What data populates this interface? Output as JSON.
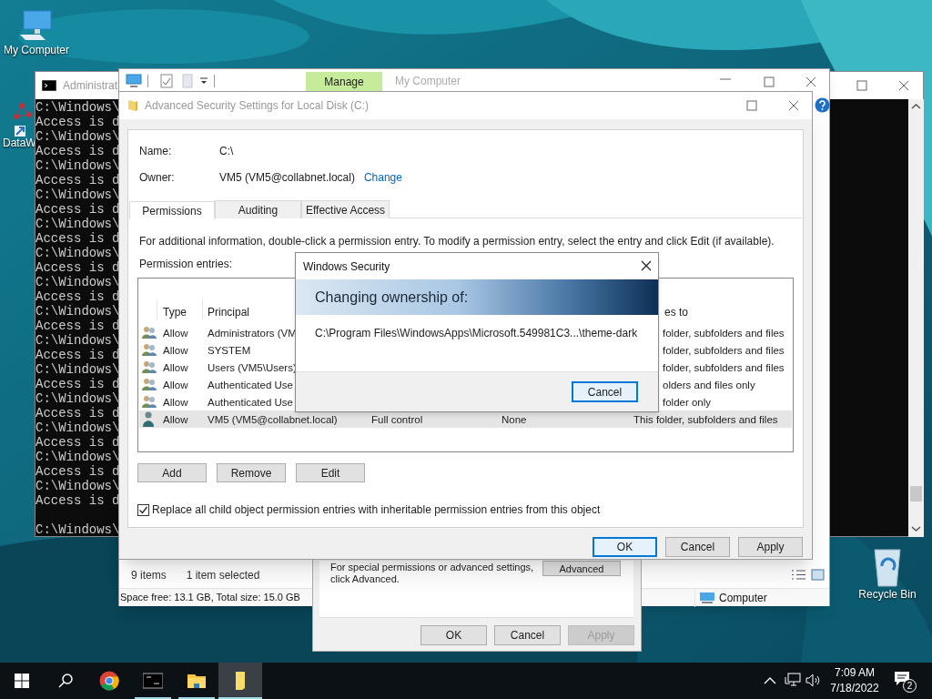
{
  "desktop_icons": [
    {
      "kind": "computer",
      "label": "My Computer"
    },
    {
      "kind": "shortcut",
      "label": "DataW"
    },
    {
      "kind": "recycle_bin",
      "label": "Recycle Bin"
    }
  ],
  "console_window": {
    "title": "Administrat",
    "lines": [
      "C:\\Windows\\",
      "Access is d",
      "C:\\Windows\\",
      "Access is d",
      "C:\\Windows\\",
      "Access is d",
      "C:\\Windows\\",
      "Access is d",
      "C:\\Windows\\",
      "Access is d",
      "C:\\Windows\\",
      "Access is d",
      "C:\\Windows\\",
      "Access is d",
      "C:\\Windows\\",
      "Access is d",
      "C:\\Windows\\",
      "Access is d",
      "C:\\Windows\\",
      "Access is d",
      "C:\\Windows\\",
      "Access is d",
      "C:\\Windows\\",
      "Access is d",
      "C:\\Windows\\",
      "Access is d",
      "C:\\Windows\\",
      "Access is d"
    ],
    "prompt": "C:\\Windows\\"
  },
  "explorer_window": {
    "ribbon_tab": "Manage",
    "title": "My Computer",
    "item_count": "9 items",
    "selection": "1 item selected",
    "details": "Space free: 13.1 GB, Total size: 15.0 GB",
    "location": "Computer"
  },
  "properties_dialog": {
    "text_lines": [
      "For special permissions or advanced settings,",
      "click Advanced."
    ],
    "advanced_button": "Advanced",
    "buttons": [
      {
        "label": "OK",
        "disabled": false
      },
      {
        "label": "Cancel",
        "disabled": false
      },
      {
        "label": "Apply",
        "disabled": true
      }
    ]
  },
  "advanced_security": {
    "title": "Advanced Security Settings for Local Disk (C:)",
    "name_label": "Name:",
    "name": "C:\\",
    "owner_label": "Owner:",
    "owner": "VM5 (VM5@collabnet.local)",
    "change_link": "Change",
    "tabs": [
      {
        "label": "Permissions",
        "selected": true
      },
      {
        "label": "Auditing",
        "selected": false
      },
      {
        "label": "Effective Access",
        "selected": false
      }
    ],
    "info": "For additional information, double-click a permission entry. To modify a permission entry, select the entry and click Edit (if available).",
    "entries_label": "Permission entries:",
    "columns": [
      "Type",
      "Principal",
      "es to"
    ],
    "rows": [
      {
        "kind": "group",
        "type": "Allow",
        "principal": "Administrators (VM",
        "applies_to": "folder, subfolders and files",
        "selected": false
      },
      {
        "kind": "group",
        "type": "Allow",
        "principal": "SYSTEM",
        "applies_to": "folder, subfolders and files",
        "selected": false
      },
      {
        "kind": "group",
        "type": "Allow",
        "principal": "Users (VM5\\Users)",
        "applies_to": "folder, subfolders and files",
        "selected": false
      },
      {
        "kind": "group",
        "type": "Allow",
        "principal": "Authenticated Use",
        "applies_to": "olders and files only",
        "selected": false
      },
      {
        "kind": "group",
        "type": "Allow",
        "principal": "Authenticated Use",
        "applies_to": "folder only",
        "selected": false
      },
      {
        "kind": "user",
        "type": "Allow",
        "principal": "VM5 (VM5@collabnet.local)",
        "access": "Full control",
        "inherited": "None",
        "applies_to": "This folder, subfolders and files",
        "selected": true
      }
    ],
    "buttons": [
      "Add",
      "Remove",
      "Edit"
    ],
    "replace_checkbox": {
      "label": "Replace all child object permission entries with inheritable permission entries from this object",
      "checked": true
    },
    "footer_buttons": [
      {
        "label": "OK",
        "default": true
      },
      {
        "label": "Cancel",
        "default": false
      },
      {
        "label": "Apply",
        "default": false
      }
    ]
  },
  "security_dialog": {
    "title": "Windows Security",
    "heading": "Changing ownership of:",
    "path": "C:\\Program Files\\WindowsApps\\Microsoft.549981C3...\\theme-dark",
    "button": {
      "label": "Cancel",
      "default": true
    }
  },
  "taskbar": {
    "apps": [
      {
        "kind": "chrome",
        "running": false,
        "selected": false
      },
      {
        "kind": "console",
        "running": true,
        "selected": false
      },
      {
        "kind": "explorer",
        "running": true,
        "selected": false
      },
      {
        "kind": "note",
        "running": true,
        "selected": true
      }
    ],
    "time": "7:09 AM",
    "date": "7/18/2022",
    "notification_count": "2"
  }
}
